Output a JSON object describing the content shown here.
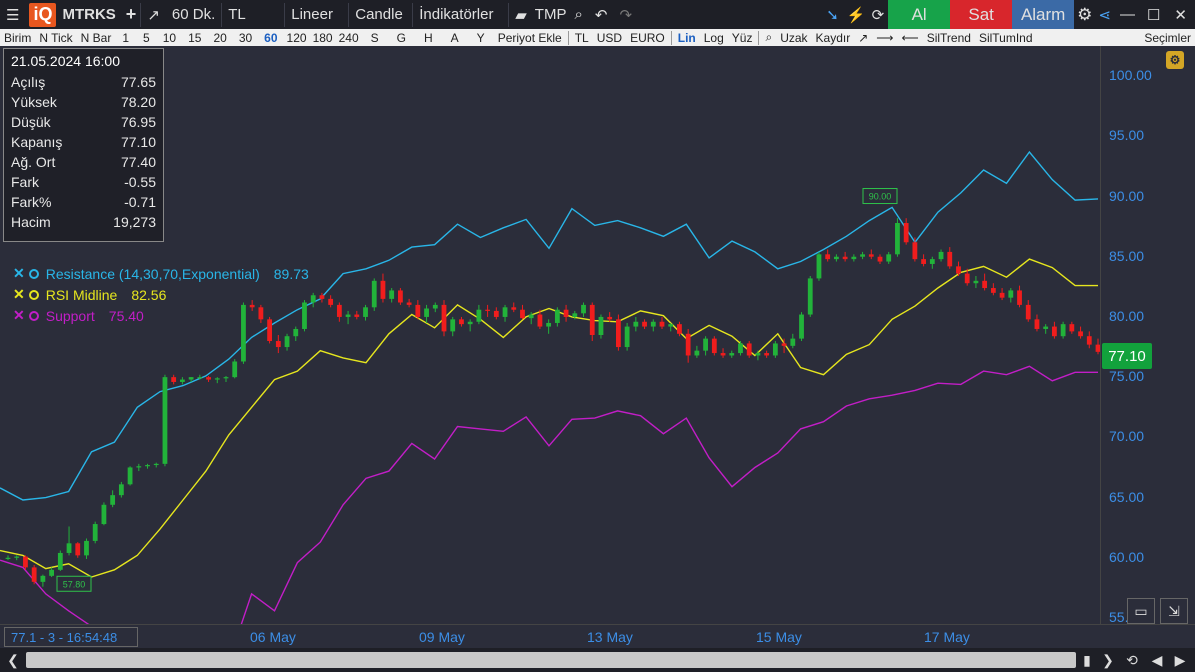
{
  "toolbar": {
    "symbol": "MTRKS",
    "add_label": "+",
    "period": "60 Dk.",
    "currency": "TL",
    "scale": "Lineer",
    "chart_type": "Candle",
    "indicators": "İndikatörler",
    "tmp": "TMP",
    "buy": "Al",
    "sell": "Sat",
    "alarm": "Alarm"
  },
  "subbar": {
    "items": [
      "Birim",
      "N Tick",
      "N Bar",
      "1",
      "5",
      "10",
      "15",
      "20",
      "30",
      "60",
      "120",
      "180",
      "240",
      "S",
      "G",
      "H",
      "A",
      "Y",
      "Periyot Ekle"
    ],
    "active_period": "60",
    "currencies": [
      "TL",
      "USD",
      "EURO"
    ],
    "scales": [
      "Lin",
      "Log",
      "Yüz"
    ],
    "tools": [
      "Uzak",
      "Kaydır"
    ],
    "trend": [
      "SilTrend",
      "SilTumInd"
    ],
    "right": "Seçimler"
  },
  "info": {
    "date": "21.05.2024 16:00",
    "rows": [
      {
        "label": "Açılış",
        "value": "77.65"
      },
      {
        "label": "Yüksek",
        "value": "78.20"
      },
      {
        "label": "Düşük",
        "value": "76.95"
      },
      {
        "label": "Kapanış",
        "value": "77.10"
      },
      {
        "label": "Ağ. Ort",
        "value": "77.40"
      },
      {
        "label": "Fark",
        "value": "-0.55"
      },
      {
        "label": "Fark%",
        "value": "-0.71"
      },
      {
        "label": "Hacim",
        "value": "19,273"
      }
    ]
  },
  "legend": [
    {
      "name": "Resistance (14,30,70,Exponential)",
      "value": "89.73",
      "color": "#29b6e8"
    },
    {
      "name": "RSI Midline",
      "value": "82.56",
      "color": "#e6e61e"
    },
    {
      "name": "Support",
      "value": "75.40",
      "color": "#c21ec7"
    }
  ],
  "price": "77.10",
  "status": "77.1 - 3 - 16:54:48",
  "labels": {
    "high": "90.00",
    "low": "57.80"
  },
  "chart_data": {
    "type": "line",
    "y_ticks": [
      "100.00",
      "95.00",
      "90.00",
      "85.00",
      "80.00",
      "75.00",
      "70.00",
      "65.00",
      "60.00",
      "55.00"
    ],
    "x_ticks": [
      "06 May",
      "09 May",
      "13 May",
      "15 May",
      "17 May"
    ],
    "ylim": [
      54.5,
      102.5
    ],
    "series": [
      {
        "name": "Resistance",
        "color": "#29b6e8",
        "values": [
          65.8,
          64.8,
          65.0,
          65.5,
          68.8,
          69.6,
          72.5,
          73.8,
          74.3,
          75.1,
          76.5,
          78.3,
          79.5,
          80.6,
          81.5,
          83.6,
          84.0,
          84.7,
          85.8,
          86.0,
          87.7,
          86.6,
          87.4,
          88.1,
          85.7,
          89.0,
          87.6,
          88.0,
          87.4,
          86.7,
          87.7,
          84.9,
          86.3,
          85.4,
          84.0,
          84.6,
          85.6,
          86.7,
          88.0,
          89.1,
          86.2,
          88.7,
          90.3,
          92.2,
          91.1,
          93.7,
          91.4,
          89.7,
          89.8
        ]
      },
      {
        "name": "RSI Midline",
        "color": "#e6e61e",
        "values": [
          60.6,
          60.2,
          59.1,
          59.5,
          58.4,
          59.0,
          60.2,
          62.4,
          64.8,
          67.2,
          70.2,
          72.5,
          74.8,
          75.5,
          77.2,
          76.6,
          76.2,
          78.6,
          80.2,
          79.1,
          81.0,
          79.8,
          78.3,
          80.0,
          80.7,
          80.0,
          79.7,
          79.6,
          80.5,
          80.1,
          78.2,
          79.3,
          78.4,
          76.8,
          78.6,
          75.8,
          75.2,
          76.9,
          77.7,
          79.8,
          80.9,
          82.4,
          83.7,
          84.2,
          83.3,
          84.8,
          84.1,
          82.6,
          82.6
        ]
      },
      {
        "name": "Support",
        "color": "#c21ec7",
        "values": [
          59.8,
          59.2,
          57.0,
          55.6,
          54.3,
          53.4,
          54.2,
          52.1,
          51.6,
          50.5,
          51.4,
          57.0,
          55.6,
          59.6,
          61.3,
          64.4,
          66.6,
          67.2,
          69.5,
          68.2,
          70.9,
          70.7,
          70.5,
          71.7,
          69.3,
          71.5,
          71.6,
          72.2,
          71.8,
          70.3,
          71.6,
          68.3,
          65.9,
          67.5,
          68.7,
          70.7,
          71.3,
          72.6,
          73.2,
          73.5,
          73.9,
          74.5,
          74.4,
          75.5,
          75.2,
          75.9,
          74.7,
          75.4,
          75.4
        ]
      }
    ],
    "candles": [
      [
        60.0,
        60.2,
        59.8,
        60.0
      ],
      [
        60.0,
        60.2,
        59.8,
        60.1
      ],
      [
        60.1,
        60.2,
        59.0,
        59.2
      ],
      [
        59.2,
        59.4,
        57.8,
        58.0
      ],
      [
        58.0,
        58.6,
        57.6,
        58.5
      ],
      [
        58.5,
        59.2,
        58.4,
        59.0
      ],
      [
        59.0,
        60.6,
        58.9,
        60.4
      ],
      [
        60.4,
        62.6,
        60.2,
        61.2
      ],
      [
        61.2,
        61.3,
        60.0,
        60.2
      ],
      [
        60.2,
        61.6,
        59.9,
        61.4
      ],
      [
        61.4,
        63.0,
        61.2,
        62.8
      ],
      [
        62.8,
        64.6,
        62.7,
        64.4
      ],
      [
        64.4,
        65.6,
        64.2,
        65.2
      ],
      [
        65.2,
        66.3,
        65.0,
        66.1
      ],
      [
        66.1,
        67.6,
        66.0,
        67.5
      ],
      [
        67.5,
        67.8,
        67.2,
        67.6
      ],
      [
        67.6,
        67.8,
        67.4,
        67.7
      ],
      [
        67.7,
        67.9,
        67.5,
        67.8
      ],
      [
        67.8,
        75.2,
        67.6,
        75.0
      ],
      [
        75.0,
        75.2,
        74.4,
        74.6
      ],
      [
        74.6,
        75.0,
        74.4,
        74.8
      ],
      [
        74.8,
        75.0,
        74.6,
        75.0
      ],
      [
        75.0,
        75.2,
        74.8,
        75.0
      ],
      [
        75.0,
        75.1,
        74.6,
        74.8
      ],
      [
        74.8,
        75.0,
        74.5,
        74.9
      ],
      [
        74.9,
        75.1,
        74.6,
        75.0
      ],
      [
        75.0,
        76.5,
        74.9,
        76.3
      ],
      [
        76.3,
        81.2,
        76.1,
        81.0
      ],
      [
        81.0,
        81.4,
        80.5,
        80.8
      ],
      [
        80.8,
        81.0,
        79.5,
        79.8
      ],
      [
        79.8,
        80.0,
        77.8,
        78.0
      ],
      [
        78.0,
        78.5,
        77.0,
        77.5
      ],
      [
        77.5,
        78.6,
        77.2,
        78.4
      ],
      [
        78.4,
        79.2,
        78.0,
        79.0
      ],
      [
        79.0,
        81.4,
        78.8,
        81.2
      ],
      [
        81.2,
        82.0,
        80.8,
        81.8
      ],
      [
        81.8,
        82.0,
        81.2,
        81.5
      ],
      [
        81.5,
        81.8,
        80.8,
        81.0
      ],
      [
        81.0,
        81.2,
        79.6,
        80.0
      ],
      [
        80.0,
        80.5,
        79.4,
        80.2
      ],
      [
        80.2,
        80.5,
        79.8,
        80.0
      ],
      [
        80.0,
        81.0,
        79.7,
        80.8
      ],
      [
        80.8,
        83.2,
        80.5,
        83.0
      ],
      [
        83.0,
        83.6,
        81.2,
        81.5
      ],
      [
        81.5,
        82.4,
        81.2,
        82.2
      ],
      [
        82.2,
        82.4,
        81.0,
        81.2
      ],
      [
        81.2,
        81.5,
        80.8,
        81.0
      ],
      [
        81.0,
        81.4,
        79.8,
        80.0
      ],
      [
        80.0,
        81.0,
        79.5,
        80.7
      ],
      [
        80.7,
        81.2,
        80.4,
        81.0
      ],
      [
        81.0,
        81.4,
        78.4,
        78.8
      ],
      [
        78.8,
        80.0,
        78.4,
        79.8
      ],
      [
        79.8,
        80.0,
        79.2,
        79.4
      ],
      [
        79.4,
        79.8,
        78.8,
        79.6
      ],
      [
        79.6,
        81.0,
        79.4,
        80.6
      ],
      [
        80.6,
        81.0,
        80.0,
        80.5
      ],
      [
        80.5,
        80.8,
        79.8,
        80.0
      ],
      [
        80.0,
        81.0,
        79.6,
        80.8
      ],
      [
        80.8,
        81.2,
        80.4,
        80.6
      ],
      [
        80.6,
        81.0,
        79.8,
        79.9
      ],
      [
        79.9,
        80.4,
        79.4,
        80.2
      ],
      [
        80.2,
        80.6,
        79.0,
        79.2
      ],
      [
        79.2,
        79.8,
        78.6,
        79.5
      ],
      [
        79.5,
        80.8,
        79.2,
        80.6
      ],
      [
        80.6,
        81.0,
        79.6,
        80.0
      ],
      [
        80.0,
        80.5,
        79.8,
        80.3
      ],
      [
        80.3,
        81.2,
        80.0,
        81.0
      ],
      [
        81.0,
        81.2,
        78.0,
        78.5
      ],
      [
        78.5,
        80.2,
        78.2,
        80.0
      ],
      [
        80.0,
        80.4,
        79.6,
        79.8
      ],
      [
        79.8,
        80.2,
        77.2,
        77.5
      ],
      [
        77.5,
        79.5,
        77.2,
        79.2
      ],
      [
        79.2,
        80.0,
        78.8,
        79.6
      ],
      [
        79.6,
        79.8,
        79.0,
        79.2
      ],
      [
        79.2,
        79.8,
        78.8,
        79.6
      ],
      [
        79.6,
        80.0,
        79.0,
        79.2
      ],
      [
        79.2,
        79.5,
        78.8,
        79.4
      ],
      [
        79.4,
        79.6,
        78.4,
        78.6
      ],
      [
        78.6,
        79.0,
        76.2,
        76.8
      ],
      [
        76.8,
        77.6,
        76.6,
        77.2
      ],
      [
        77.2,
        78.4,
        76.8,
        78.2
      ],
      [
        78.2,
        78.4,
        76.8,
        77.0
      ],
      [
        77.0,
        77.4,
        76.6,
        76.8
      ],
      [
        76.8,
        77.2,
        76.6,
        77.0
      ],
      [
        77.0,
        78.0,
        76.8,
        77.8
      ],
      [
        77.8,
        78.0,
        76.6,
        76.8
      ],
      [
        76.8,
        77.2,
        76.4,
        77.0
      ],
      [
        77.0,
        77.2,
        76.6,
        76.8
      ],
      [
        76.8,
        78.0,
        76.6,
        77.8
      ],
      [
        77.8,
        78.2,
        77.0,
        77.6
      ],
      [
        77.6,
        78.6,
        77.4,
        78.2
      ],
      [
        78.2,
        80.4,
        78.0,
        80.2
      ],
      [
        80.2,
        83.4,
        80.0,
        83.2
      ],
      [
        83.2,
        85.4,
        83.0,
        85.2
      ],
      [
        85.2,
        85.6,
        84.6,
        84.8
      ],
      [
        84.8,
        85.2,
        84.6,
        85.0
      ],
      [
        85.0,
        85.4,
        84.6,
        84.8
      ],
      [
        84.8,
        85.2,
        84.6,
        85.0
      ],
      [
        85.0,
        85.4,
        84.8,
        85.2
      ],
      [
        85.2,
        85.6,
        84.8,
        85.0
      ],
      [
        85.0,
        85.2,
        84.4,
        84.6
      ],
      [
        84.6,
        85.4,
        84.4,
        85.2
      ],
      [
        85.2,
        88.2,
        85.0,
        87.8
      ],
      [
        87.8,
        88.2,
        86.0,
        86.2
      ],
      [
        86.2,
        86.6,
        84.6,
        84.8
      ],
      [
        84.8,
        85.2,
        84.2,
        84.4
      ],
      [
        84.4,
        85.0,
        84.0,
        84.8
      ],
      [
        84.8,
        85.6,
        84.6,
        85.4
      ],
      [
        85.4,
        85.8,
        84.0,
        84.2
      ],
      [
        84.2,
        84.6,
        83.4,
        83.6
      ],
      [
        83.6,
        84.0,
        82.6,
        82.8
      ],
      [
        82.8,
        83.4,
        82.4,
        83.0
      ],
      [
        83.0,
        83.6,
        82.2,
        82.4
      ],
      [
        82.4,
        82.8,
        81.8,
        82.0
      ],
      [
        82.0,
        82.4,
        81.4,
        81.6
      ],
      [
        81.6,
        82.4,
        81.2,
        82.2
      ],
      [
        82.2,
        82.6,
        80.8,
        81.0
      ],
      [
        81.0,
        81.4,
        79.6,
        79.8
      ],
      [
        79.8,
        80.2,
        78.8,
        79.0
      ],
      [
        79.0,
        79.4,
        78.6,
        79.2
      ],
      [
        79.2,
        79.6,
        78.2,
        78.4
      ],
      [
        78.4,
        79.6,
        78.2,
        79.4
      ],
      [
        79.4,
        79.6,
        78.6,
        78.8
      ],
      [
        78.8,
        79.2,
        78.2,
        78.4
      ],
      [
        78.4,
        78.8,
        77.4,
        77.7
      ],
      [
        77.7,
        78.2,
        76.9,
        77.1
      ]
    ]
  }
}
